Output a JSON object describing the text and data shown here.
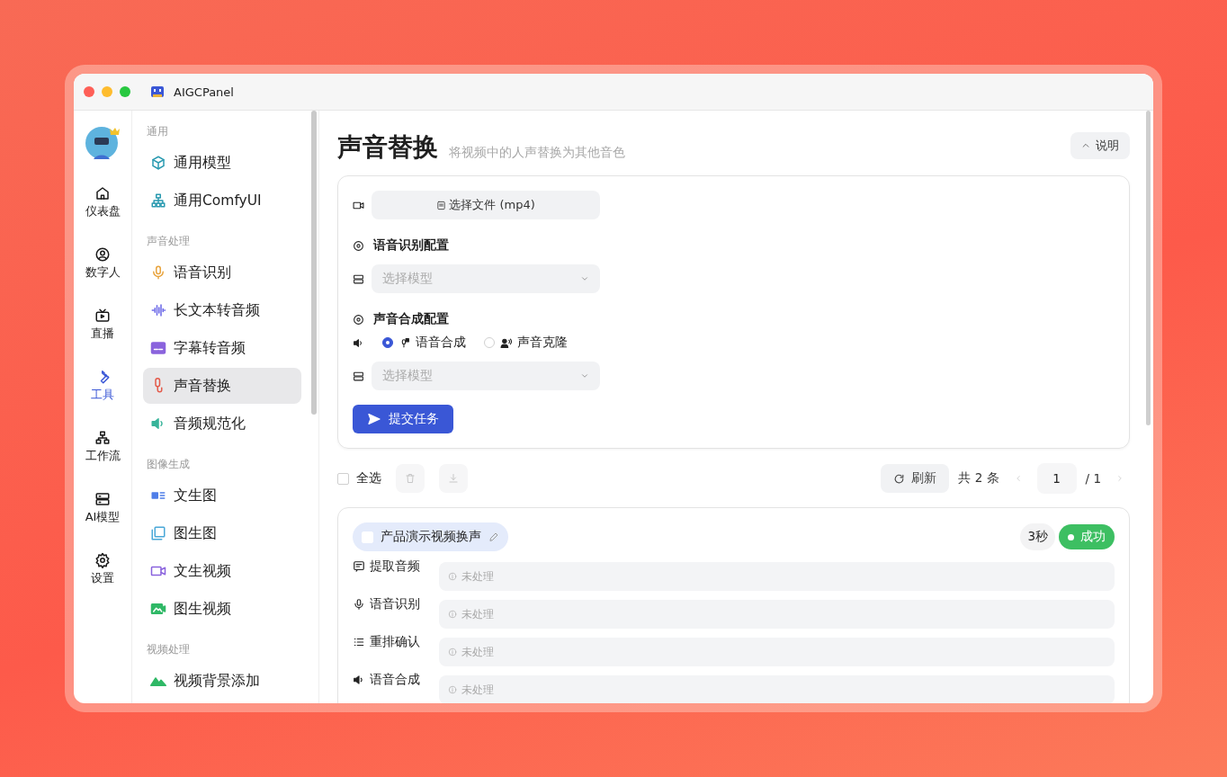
{
  "window": {
    "title": "AIGCPanel"
  },
  "rail": [
    {
      "label": "仪表盘",
      "selected": false
    },
    {
      "label": "数字人",
      "selected": false
    },
    {
      "label": "直播",
      "selected": false
    },
    {
      "label": "工具",
      "selected": true
    },
    {
      "label": "工作流",
      "selected": false
    },
    {
      "label": "AI模型",
      "selected": false
    },
    {
      "label": "设置",
      "selected": false
    }
  ],
  "sidebar": [
    {
      "heading": "通用",
      "items": [
        {
          "label": "通用模型",
          "selected": false
        },
        {
          "label": "通用ComfyUI",
          "selected": false
        }
      ]
    },
    {
      "heading": "声音处理",
      "items": [
        {
          "label": "语音识别",
          "selected": false
        },
        {
          "label": "长文本转音频",
          "selected": false
        },
        {
          "label": "字幕转音频",
          "selected": false
        },
        {
          "label": "声音替换",
          "selected": true
        },
        {
          "label": "音频规范化",
          "selected": false
        }
      ]
    },
    {
      "heading": "图像生成",
      "items": [
        {
          "label": "文生图",
          "selected": false
        },
        {
          "label": "图生图",
          "selected": false
        },
        {
          "label": "文生视频",
          "selected": false
        },
        {
          "label": "图生视频",
          "selected": false
        }
      ]
    },
    {
      "heading": "视频处理",
      "items": [
        {
          "label": "视频背景添加",
          "selected": false
        }
      ]
    }
  ],
  "page": {
    "title": "声音替换",
    "subtitle": "将视频中的人声替换为其他音色",
    "help_button": "说明"
  },
  "form": {
    "file_button": "选择文件 (mp4)",
    "asr_heading": "语音识别配置",
    "asr_select": {
      "placeholder": "选择模型"
    },
    "tts_heading": "声音合成配置",
    "modes": [
      {
        "label": "语音合成",
        "selected": true
      },
      {
        "label": "声音克隆",
        "selected": false
      }
    ],
    "tts_select": {
      "placeholder": "选择模型"
    },
    "submit": "提交任务"
  },
  "toolbar": {
    "select_all": {
      "label": "全选",
      "checked": false
    },
    "refresh": "刷新",
    "total": "共 2 条",
    "page_input": "1",
    "page_count": "/ 1"
  },
  "task": {
    "name": "产品演示视频换声",
    "checked": false,
    "duration": "3秒",
    "status": {
      "label": "成功",
      "color": "#3dbf62"
    },
    "steps": [
      {
        "label": "提取音频",
        "status": "未处理"
      },
      {
        "label": "语音识别",
        "status": "未处理"
      },
      {
        "label": "重排确认",
        "status": "未处理"
      },
      {
        "label": "语音合成",
        "status": "未处理"
      }
    ]
  }
}
